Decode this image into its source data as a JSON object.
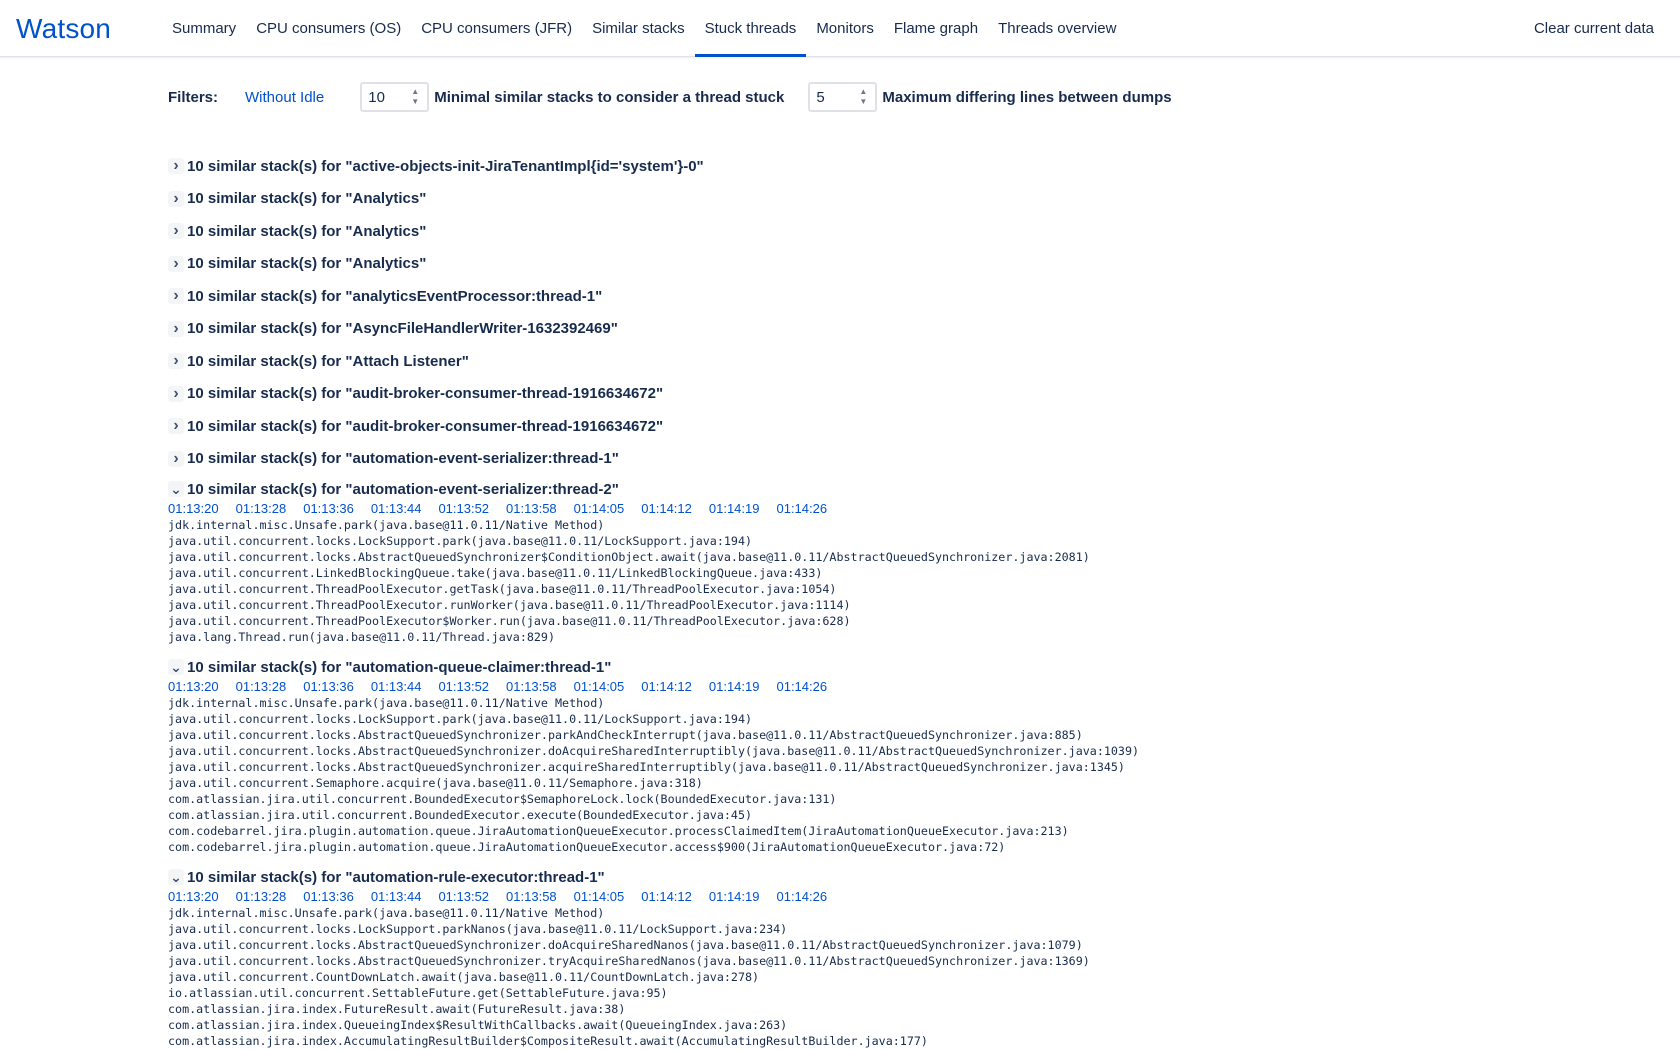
{
  "app": {
    "logo": "Watson"
  },
  "nav": {
    "tabs": [
      {
        "label": "Summary"
      },
      {
        "label": "CPU consumers (OS)"
      },
      {
        "label": "CPU consumers (JFR)"
      },
      {
        "label": "Similar stacks"
      },
      {
        "label": "Stuck threads",
        "active": true
      },
      {
        "label": "Monitors"
      },
      {
        "label": "Flame graph"
      },
      {
        "label": "Threads overview"
      }
    ],
    "clear_label": "Clear current data"
  },
  "filters": {
    "label": "Filters:",
    "chip": "Without Idle",
    "min_similar_value": "10",
    "min_similar_label": "Minimal similar stacks to consider a thread stuck",
    "max_diff_value": "5",
    "max_diff_label": "Maximum differing lines between dumps"
  },
  "collapsed_threads": [
    {
      "title": "10 similar stack(s) for \"active-objects-init-JiraTenantImpl{id='system'}-0\""
    },
    {
      "title": "10 similar stack(s) for \"Analytics\""
    },
    {
      "title": "10 similar stack(s) for \"Analytics\""
    },
    {
      "title": "10 similar stack(s) for \"Analytics\""
    },
    {
      "title": "10 similar stack(s) for \"analyticsEventProcessor:thread-1\""
    },
    {
      "title": "10 similar stack(s) for \"AsyncFileHandlerWriter-1632392469\""
    },
    {
      "title": "10 similar stack(s) for \"Attach Listener\""
    },
    {
      "title": "10 similar stack(s) for \"audit-broker-consumer-thread-1916634672\""
    },
    {
      "title": "10 similar stack(s) for \"audit-broker-consumer-thread-1916634672\""
    },
    {
      "title": "10 similar stack(s) for \"automation-event-serializer:thread-1\""
    }
  ],
  "timestamps": [
    "01:13:20",
    "01:13:28",
    "01:13:36",
    "01:13:44",
    "01:13:52",
    "01:13:58",
    "01:14:05",
    "01:14:12",
    "01:14:19",
    "01:14:26"
  ],
  "expanded_threads": [
    {
      "title": "10 similar stack(s) for \"automation-event-serializer:thread-2\"",
      "frames": [
        "jdk.internal.misc.Unsafe.park(java.base@11.0.11/Native Method)",
        "java.util.concurrent.locks.LockSupport.park(java.base@11.0.11/LockSupport.java:194)",
        "java.util.concurrent.locks.AbstractQueuedSynchronizer$ConditionObject.await(java.base@11.0.11/AbstractQueuedSynchronizer.java:2081)",
        "java.util.concurrent.LinkedBlockingQueue.take(java.base@11.0.11/LinkedBlockingQueue.java:433)",
        "java.util.concurrent.ThreadPoolExecutor.getTask(java.base@11.0.11/ThreadPoolExecutor.java:1054)",
        "java.util.concurrent.ThreadPoolExecutor.runWorker(java.base@11.0.11/ThreadPoolExecutor.java:1114)",
        "java.util.concurrent.ThreadPoolExecutor$Worker.run(java.base@11.0.11/ThreadPoolExecutor.java:628)",
        "java.lang.Thread.run(java.base@11.0.11/Thread.java:829)"
      ]
    },
    {
      "title": "10 similar stack(s) for \"automation-queue-claimer:thread-1\"",
      "frames": [
        "jdk.internal.misc.Unsafe.park(java.base@11.0.11/Native Method)",
        "java.util.concurrent.locks.LockSupport.park(java.base@11.0.11/LockSupport.java:194)",
        "java.util.concurrent.locks.AbstractQueuedSynchronizer.parkAndCheckInterrupt(java.base@11.0.11/AbstractQueuedSynchronizer.java:885)",
        "java.util.concurrent.locks.AbstractQueuedSynchronizer.doAcquireSharedInterruptibly(java.base@11.0.11/AbstractQueuedSynchronizer.java:1039)",
        "java.util.concurrent.locks.AbstractQueuedSynchronizer.acquireSharedInterruptibly(java.base@11.0.11/AbstractQueuedSynchronizer.java:1345)",
        "java.util.concurrent.Semaphore.acquire(java.base@11.0.11/Semaphore.java:318)",
        "com.atlassian.jira.util.concurrent.BoundedExecutor$SemaphoreLock.lock(BoundedExecutor.java:131)",
        "com.atlassian.jira.util.concurrent.BoundedExecutor.execute(BoundedExecutor.java:45)",
        "com.codebarrel.jira.plugin.automation.queue.JiraAutomationQueueExecutor.processClaimedItem(JiraAutomationQueueExecutor.java:213)",
        "com.codebarrel.jira.plugin.automation.queue.JiraAutomationQueueExecutor.access$900(JiraAutomationQueueExecutor.java:72)"
      ]
    },
    {
      "title": "10 similar stack(s) for \"automation-rule-executor:thread-1\"",
      "frames": [
        "jdk.internal.misc.Unsafe.park(java.base@11.0.11/Native Method)",
        "java.util.concurrent.locks.LockSupport.parkNanos(java.base@11.0.11/LockSupport.java:234)",
        "java.util.concurrent.locks.AbstractQueuedSynchronizer.doAcquireSharedNanos(java.base@11.0.11/AbstractQueuedSynchronizer.java:1079)",
        "java.util.concurrent.locks.AbstractQueuedSynchronizer.tryAcquireSharedNanos(java.base@11.0.11/AbstractQueuedSynchronizer.java:1369)",
        "java.util.concurrent.CountDownLatch.await(java.base@11.0.11/CountDownLatch.java:278)",
        "io.atlassian.util.concurrent.SettableFuture.get(SettableFuture.java:95)",
        "com.atlassian.jira.index.FutureResult.await(FutureResult.java:38)",
        "com.atlassian.jira.index.QueueingIndex$ResultWithCallbacks.await(QueueingIndex.java:263)",
        "com.atlassian.jira.index.AccumulatingResultBuilder$CompositeResult.await(AccumulatingResultBuilder.java:177)"
      ]
    }
  ]
}
